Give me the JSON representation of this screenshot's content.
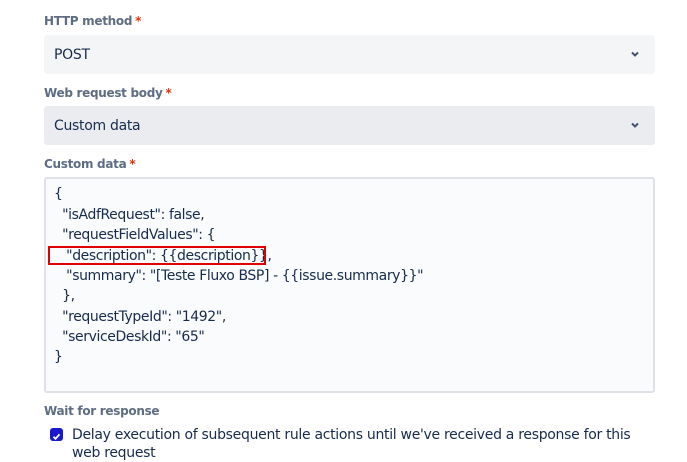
{
  "http_method": {
    "label": "HTTP method",
    "required": "*",
    "value": "POST"
  },
  "body_type": {
    "label": "Web request body",
    "required": "*",
    "value": "Custom data"
  },
  "custom_data": {
    "label": "Custom data",
    "required": "*",
    "lines": [
      "{",
      "  \"isAdfRequest\": false,",
      "  \"requestFieldValues\": {",
      "   \"description\": {{description}},",
      "   \"summary\": \"[Teste Fluxo BSP] - {{issue.summary}}\"",
      "  },",
      "  \"requestTypeId\": \"1492\",",
      "  \"serviceDeskId\": \"65\"",
      "}"
    ]
  },
  "wait": {
    "label": "Wait for response",
    "checkbox_label": "Delay execution of subsequent rule actions until we've received a response for this web request",
    "checked": true
  }
}
